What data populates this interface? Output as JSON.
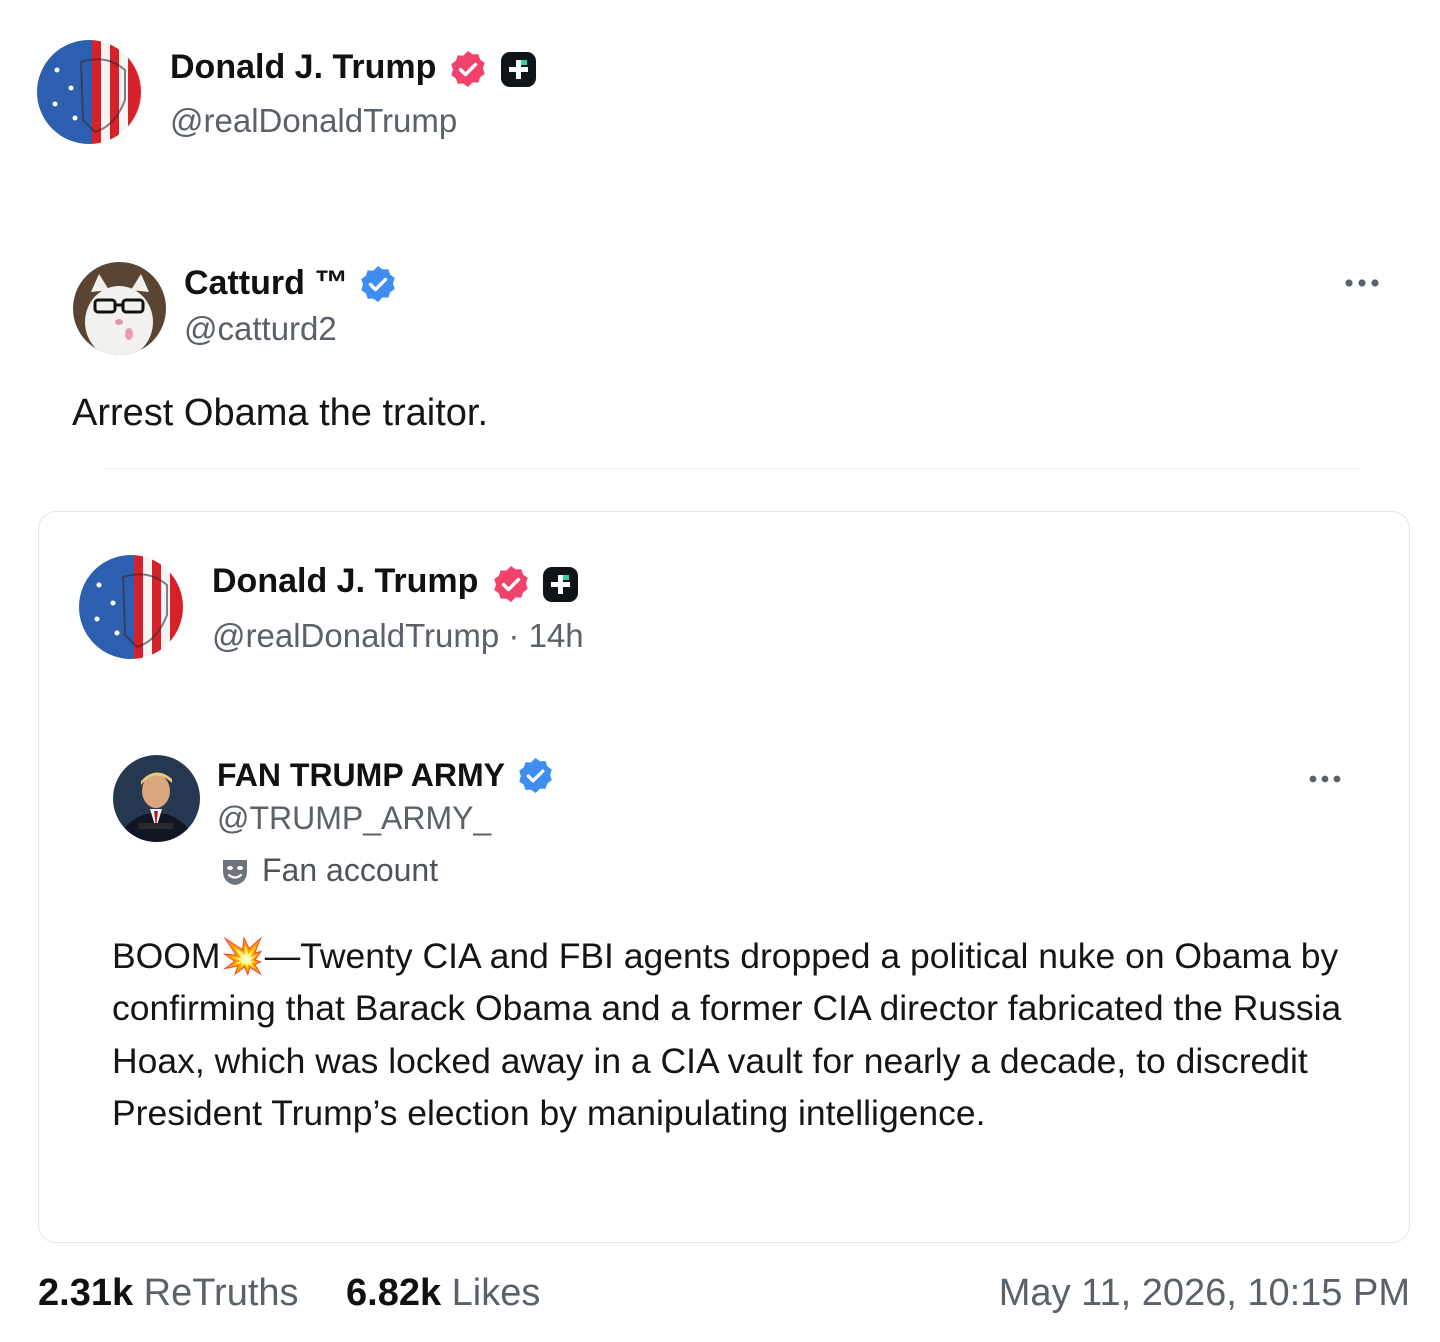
{
  "header": {
    "author_name": "Donald J. Trump",
    "author_handle": "@realDonaldTrump"
  },
  "retruth": {
    "author_name": "Catturd ™",
    "author_handle": "@catturd2",
    "text": "Arrest Obama the traitor.",
    "more_icon": "more-horizontal-icon"
  },
  "quote": {
    "author_name": "Donald J. Trump",
    "author_handle": "@realDonaldTrump",
    "time_separator": "·",
    "time": "14h",
    "inner": {
      "author_name": "FAN TRUMP ARMY",
      "author_handle": "@TRUMP_ARMY_",
      "account_label": "Fan account",
      "text_prefix": "BOOM",
      "emoji": "💥",
      "text_suffix": "—Twenty CIA and FBI agents dropped a political nuke on Obama by confirming that Barack Obama and a former CIA director fabricated the Russia Hoax, which was locked away in a CIA vault for nearly a decade, to discredit President Trump’s election by manipulating intelligence.",
      "more_icon": "more-horizontal-icon"
    }
  },
  "stats": {
    "retruths_count": "2.31k",
    "retruths_label": "ReTruths",
    "likes_count": "6.82k",
    "likes_label": "Likes",
    "timestamp": "May 11, 2026, 10:15 PM"
  },
  "colors": {
    "truth_badge": "#f0426a",
    "verified_badge": "#3d8ef0",
    "plus_badge": "#0f1419",
    "secondary_text": "#5b6169",
    "border": "#e3e5e8"
  }
}
